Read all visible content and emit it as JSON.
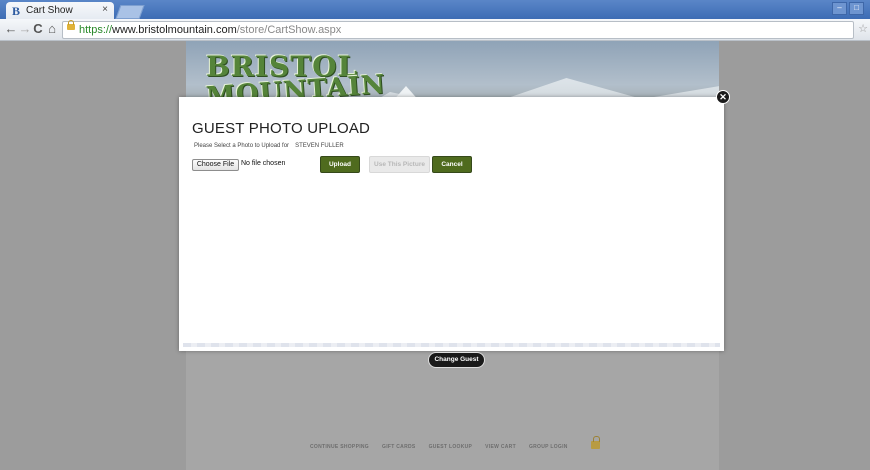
{
  "browser": {
    "tab_title": "Cart Show",
    "tab_close": "×",
    "favicon_letter": "B",
    "url_scheme": "https://",
    "url_host": "www.bristolmountain.com",
    "url_path": "/store/CartShow.aspx",
    "nav": {
      "back": "←",
      "forward": "→",
      "reload": "C",
      "home": "⌂"
    },
    "star": "☆",
    "window_controls": [
      "–",
      "□"
    ]
  },
  "banner": {
    "logo_line1": "BRISTOL",
    "logo_line2": "MOUNTAIN"
  },
  "modal": {
    "title": "GUEST PHOTO UPLOAD",
    "prompt": "Please Select a Photo to Upload for",
    "guest_name": "STEVEN FULLER",
    "choose_file_label": "Choose File",
    "no_file_text": "No file chosen",
    "upload_label": "Upload",
    "use_picture_label": "Use This Picture",
    "cancel_label": "Cancel",
    "close_icon": "✕"
  },
  "change_guest_label": "Change Guest",
  "footer_nav": [
    "CONTINUE SHOPPING",
    "GIFT CARDS",
    "GUEST LOOKUP",
    "VIEW CART",
    "GROUP LOGIN"
  ],
  "colors": {
    "accent_green": "#4f6b1e",
    "overlay_gray": "#9c9c9c"
  }
}
